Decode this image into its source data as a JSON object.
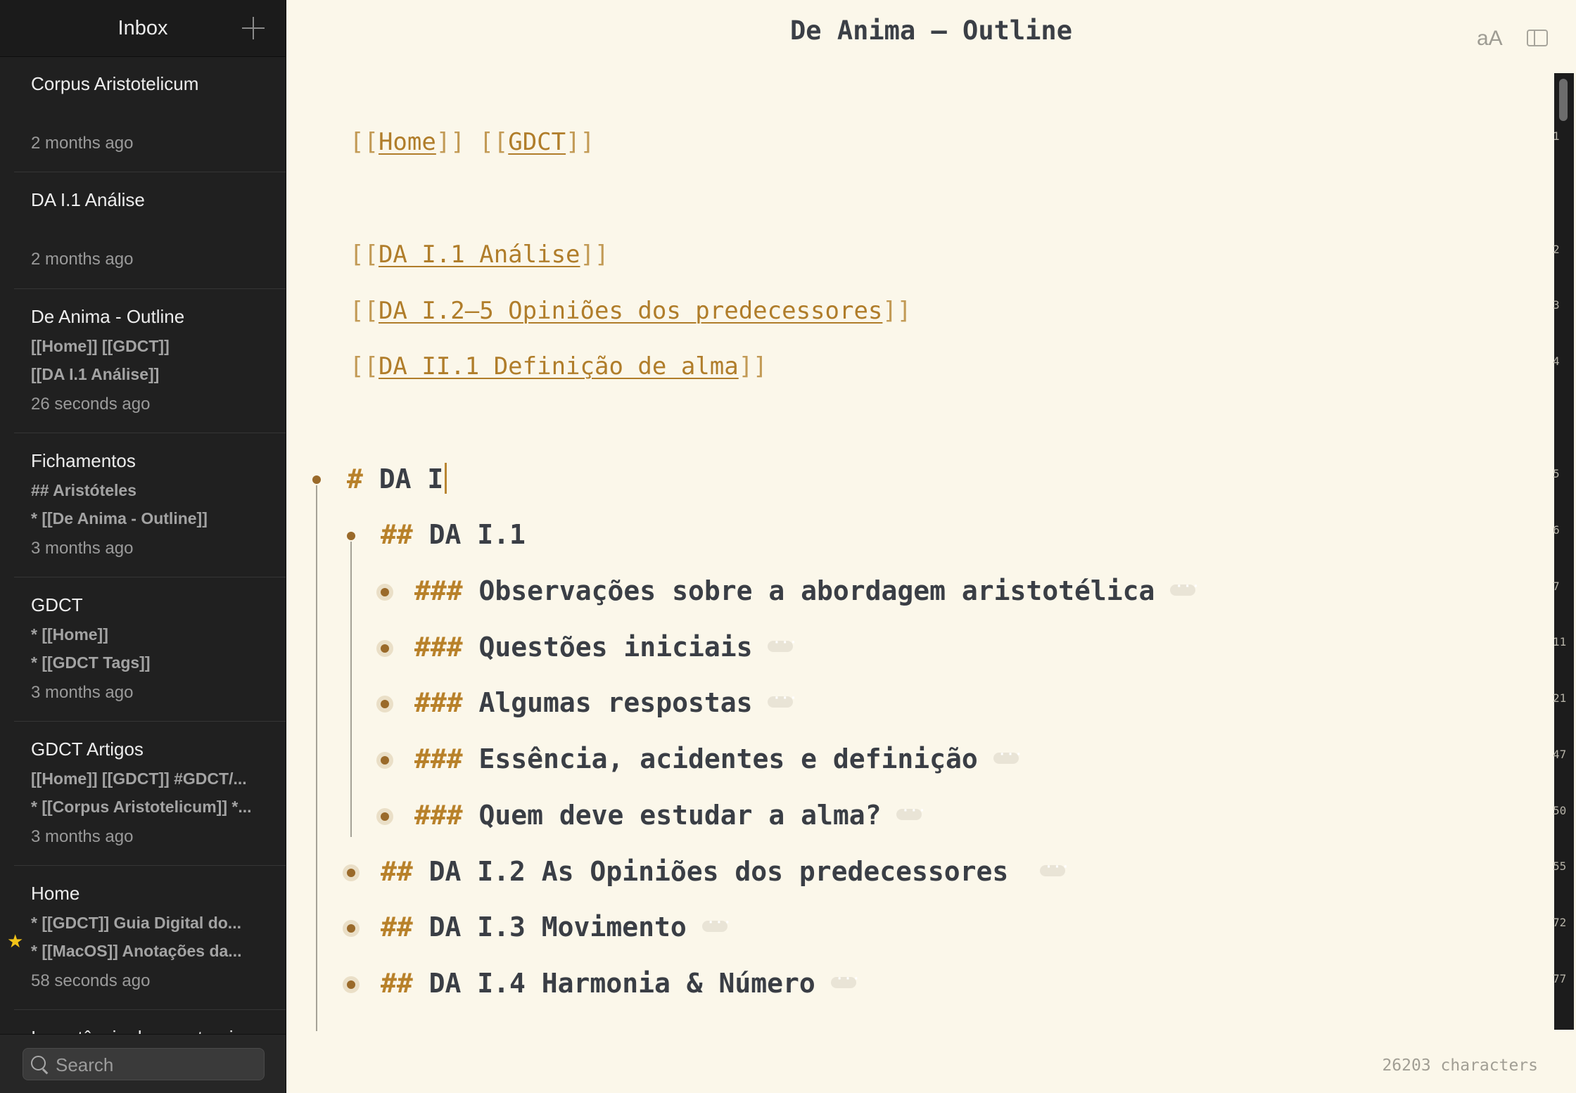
{
  "sidebar": {
    "title": "Inbox",
    "notes": [
      {
        "title": "Corpus Aristotelicum",
        "preview": [],
        "time": "2 months ago",
        "starred": false
      },
      {
        "title": "DA I.1 Análise",
        "preview": [],
        "time": "2 months ago",
        "starred": false
      },
      {
        "title": "De Anima - Outline",
        "preview": [
          "[[Home]] [[GDCT]]",
          "[[DA I.1 Análise]]"
        ],
        "time": "26 seconds ago",
        "starred": false
      },
      {
        "title": "Fichamentos",
        "preview": [
          "## Aristóteles",
          "* [[De Anima - Outline]]"
        ],
        "time": "3 months ago",
        "starred": false
      },
      {
        "title": "GDCT",
        "preview": [
          "* [[Home]]",
          "* [[GDCT Tags]]"
        ],
        "time": "3 months ago",
        "starred": false
      },
      {
        "title": "GDCT Artigos",
        "preview": [
          "[[Home]] [[GDCT]] #GDCT/...",
          "* [[Corpus Aristotelicum]] *..."
        ],
        "time": "3 months ago",
        "starred": false
      },
      {
        "title": "Home",
        "preview": [
          "* [[GDCT]] Guia Digital do...",
          "* [[MacOS]] Anotações da..."
        ],
        "time": "58 seconds ago",
        "starred": true
      },
      {
        "title": "Importância de uma teoria",
        "preview": [],
        "time": "",
        "starred": false
      }
    ],
    "search_placeholder": "Search"
  },
  "editor": {
    "title": "De Anima – Outline",
    "font_button": "aA",
    "links": {
      "home": "Home",
      "gdct": "GDCT",
      "da11": "DA I.1 Análise",
      "da125": "DA I.2–5 Opiniões dos predecessores",
      "da21": "DA II.1 Definição de alma"
    },
    "headings": {
      "h1_mark": "#",
      "h1": "DA I",
      "h2_mark": "##",
      "h3_mark": "###",
      "h2_a": "DA I.1",
      "h3_a": "Observações sobre a abordagem aristotélica",
      "h3_b": "Questões iniciais",
      "h3_c": "Algumas respostas",
      "h3_d": "Essência, acidentes e definição",
      "h3_e": "Quem deve estudar a alma?",
      "h2_b": "DA I.2 As Opiniões dos predecessores",
      "h2_c": "DA I.3 Movimento",
      "h2_d": "DA I.4 Harmonia & Número"
    },
    "line_numbers": [
      "1",
      "2",
      "3",
      "4",
      "5",
      "6",
      "7",
      "11",
      "21",
      "47",
      "50",
      "55",
      "72",
      "77"
    ],
    "character_count": "26203 characters"
  },
  "colors": {
    "sidebar_bg": "#202020",
    "editor_bg": "#fbf7ea",
    "accent": "#b68431",
    "heading_text": "#3a3e45"
  }
}
